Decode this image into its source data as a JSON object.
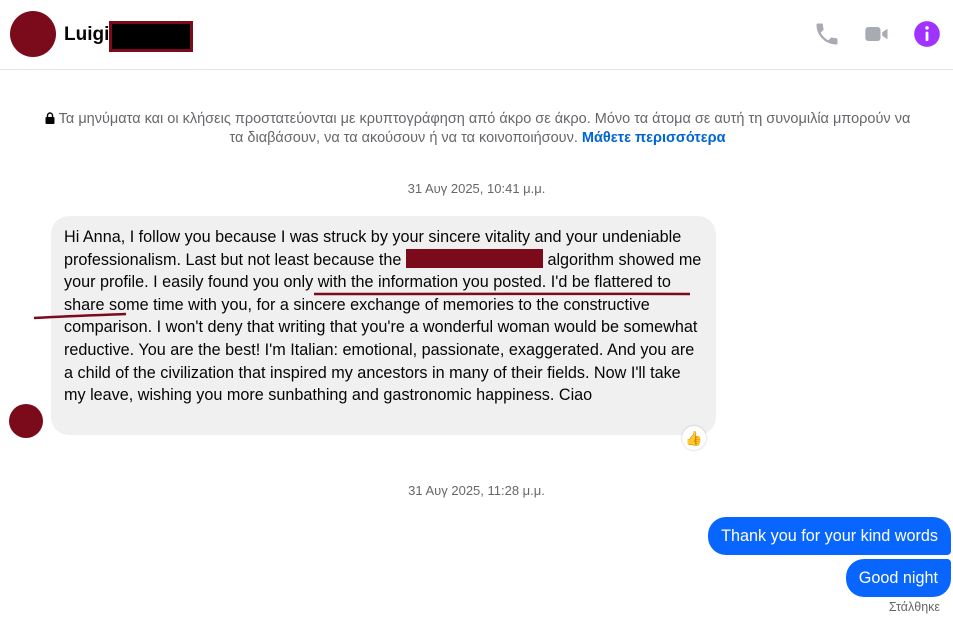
{
  "header": {
    "contact_name": "Luigi",
    "icons": [
      "phone-icon",
      "video-icon",
      "info-icon"
    ],
    "accent_color": "#a033ff"
  },
  "e2e_notice": {
    "text": "Τα μηνύματα και οι κλήσεις προστατεύονται με κρυπτογράφηση από άκρο σε άκρο. Μόνο τα άτομα σε αυτή τη συνομιλία μπορούν να τα διαβάσουν, να τα ακούσουν ή να τα κοινοποιήσουν.",
    "link": "Μάθετε περισσότερα"
  },
  "conversation": {
    "timestamp_1": "31 Αυγ 2025, 10:41 μ.μ.",
    "incoming_message": {
      "part1": "Hi Anna, I follow you because I was struck by your sincere vitality and your undeniable professionalism. Last but not least because the",
      "part2": "algorithm showed me your profile",
      "part3": ". I easily found you only with the information you posted. I'd be flattered to share some time with you, for a sincere exchange of memories to the constructive comparison. I won't deny that writing that you're a wonderful woman would be somewhat reductive. You are the best! I'm Italian: emotional, passionate, exaggerated. And you are a child of the civilization that inspired my ancestors in many of their fields. Now I'll take my leave, wishing you more sunbathing and gastronomic happiness. Ciao",
      "reaction": "👍"
    },
    "timestamp_2": "31 Αυγ 2025, 11:28 μ.μ.",
    "outgoing_messages": [
      "Thank you for your kind words",
      "Good night"
    ],
    "status": "Στάλθηκε"
  },
  "colors": {
    "outgoing_bubble": "#0866ff",
    "incoming_bubble": "#f0f0f0",
    "redaction": "#7b0a1a"
  }
}
